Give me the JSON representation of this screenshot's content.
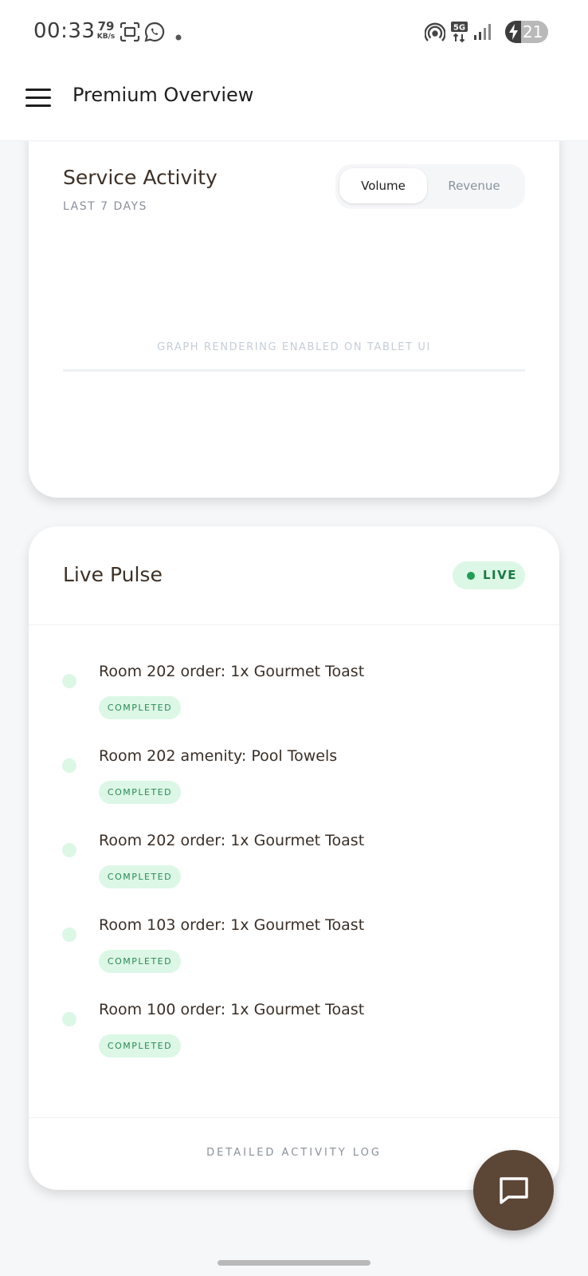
{
  "status_bar": {
    "time": "00:33",
    "net_speed_value": "79",
    "net_speed_unit": "KB/s",
    "network_type": "5G",
    "battery_level": "21",
    "icons": [
      "screenshot-icon",
      "whatsapp-icon",
      "dot-icon",
      "hotspot-icon",
      "5g-icon",
      "signal-icon",
      "battery-charging-icon"
    ]
  },
  "app_bar": {
    "title": "Premium Overview",
    "menu_icon": "hamburger-menu-icon"
  },
  "service_activity": {
    "title": "Service Activity",
    "subtitle": "LAST 7 DAYS",
    "toggle": {
      "options": [
        "Volume",
        "Revenue"
      ],
      "selected": "Volume"
    },
    "graph_placeholder": "GRAPH RENDERING ENABLED ON TABLET UI"
  },
  "live_pulse": {
    "title": "Live Pulse",
    "badge": "LIVE",
    "items": [
      {
        "text": "Room 202 order: 1x Gourmet Toast",
        "status": "COMPLETED"
      },
      {
        "text": "Room 202 amenity: Pool Towels",
        "status": "COMPLETED"
      },
      {
        "text": "Room 202 order: 1x Gourmet Toast",
        "status": "COMPLETED"
      },
      {
        "text": "Room 103 order: 1x Gourmet Toast",
        "status": "COMPLETED"
      },
      {
        "text": "Room 100 order: 1x Gourmet Toast",
        "status": "COMPLETED"
      }
    ],
    "footer_link": "DETAILED ACTIVITY LOG"
  },
  "fab": {
    "icon": "chat-bubble-icon"
  },
  "colors": {
    "accent_brown": "#5c4636",
    "success_bg": "#dcf7e6",
    "success_text": "#2a8a55",
    "live_dot": "#1f9e58"
  }
}
